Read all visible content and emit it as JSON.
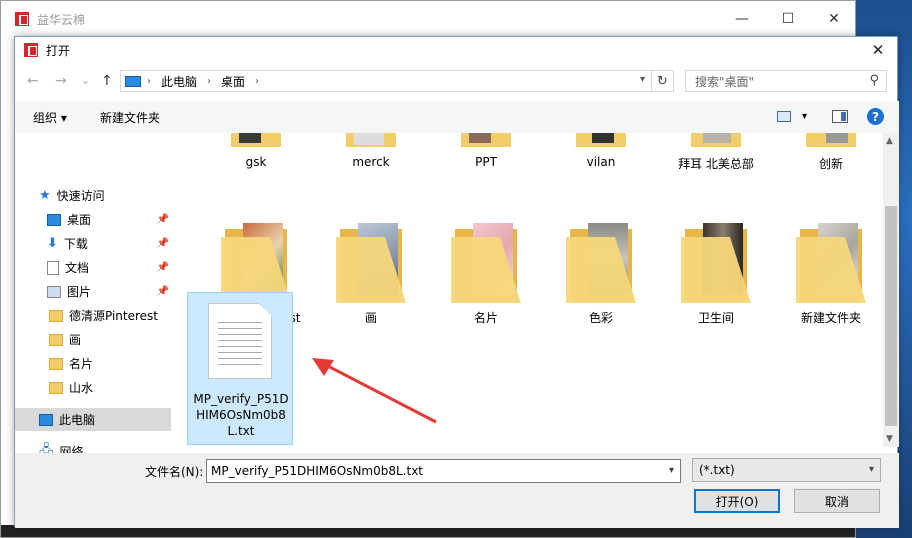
{
  "background_window": {
    "title": "益华云棉",
    "minimize": "—",
    "maximize": "☐",
    "close": "✕"
  },
  "dialog": {
    "title": "打开",
    "close": "✕"
  },
  "nav": {
    "back": "←",
    "forward": "→",
    "recent": "⌄",
    "up": "↑",
    "breadcrumbs": [
      "此电脑",
      "桌面"
    ],
    "refresh": "↻",
    "search_placeholder": "搜索\"桌面\""
  },
  "toolbar": {
    "organize": "组织",
    "new_folder": "新建文件夹"
  },
  "sidebar": {
    "items": [
      {
        "label": "快速访问"
      },
      {
        "label": "桌面"
      },
      {
        "label": "下载"
      },
      {
        "label": "文档"
      },
      {
        "label": "图片"
      },
      {
        "label": "德清源Pinterest"
      },
      {
        "label": "画"
      },
      {
        "label": "名片"
      },
      {
        "label": "山水"
      },
      {
        "label": "此电脑"
      },
      {
        "label": "网络"
      }
    ]
  },
  "files_top": [
    "gsk",
    "merck",
    "PPT",
    "vilan",
    "拜耳 北美总部",
    "创新"
  ],
  "files_row2": [
    "德清源Pinterest",
    "画",
    "名片",
    "色彩",
    "卫生间",
    "新建文件夹"
  ],
  "selected_file": {
    "name": "MP_verify_P51DHIM6OsNm0b8L.txt"
  },
  "bottom": {
    "filename_label": "文件名(N):",
    "filename_value": "MP_verify_P51DHIM6OsNm0b8L.txt",
    "filter": "(*.txt)",
    "open": "打开(O)",
    "cancel": "取消"
  },
  "colors": {
    "accent": "#0078d7",
    "selection": "#cce8ff",
    "annotation_arrow": "#e53935",
    "folder": "#f7d77a"
  }
}
